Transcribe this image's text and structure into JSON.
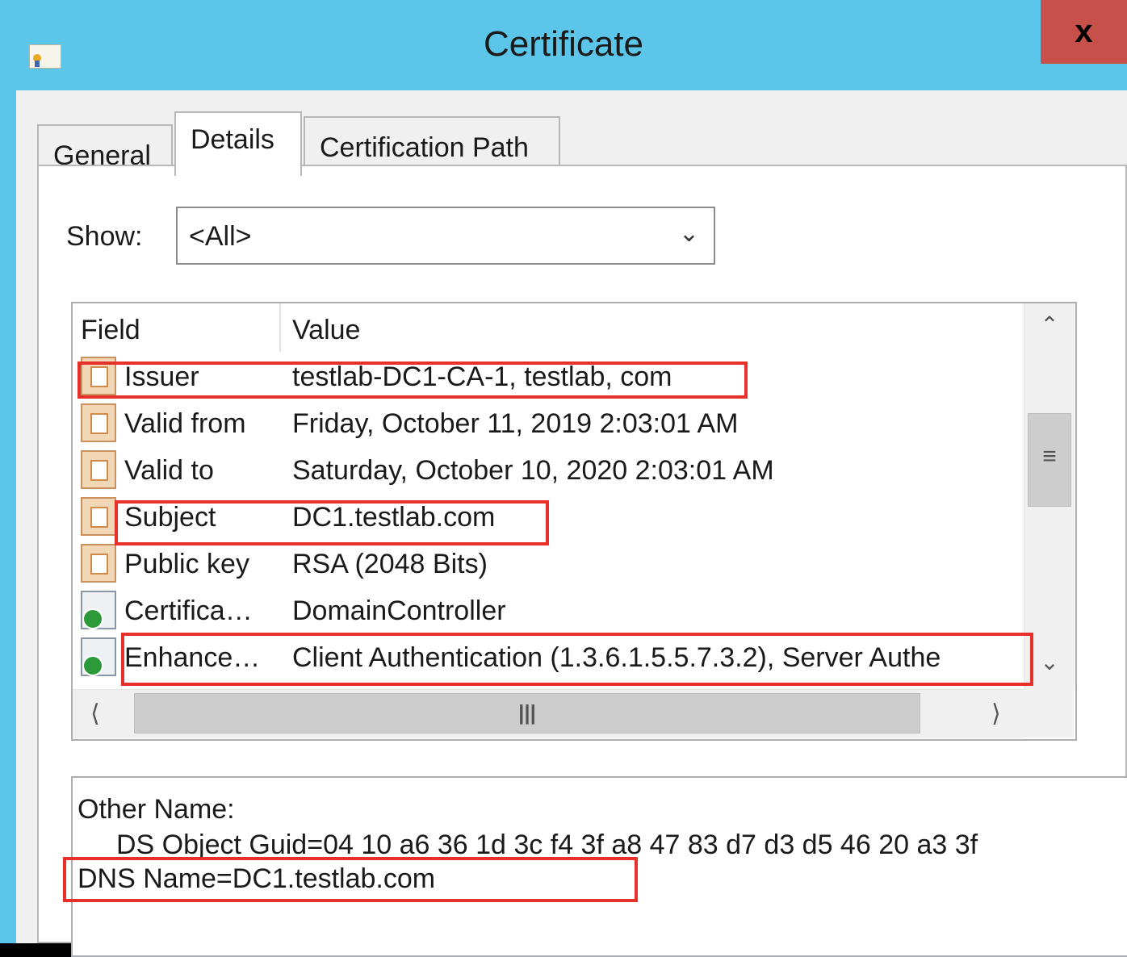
{
  "window": {
    "title": "Certificate",
    "close_label": "x"
  },
  "tabs": [
    {
      "label": "General",
      "active": false
    },
    {
      "label": "Details",
      "active": true
    },
    {
      "label": "Certification Path",
      "active": false
    }
  ],
  "show": {
    "label": "Show:",
    "value": "<All>"
  },
  "list": {
    "columns": [
      "Field",
      "Value"
    ],
    "rows": [
      {
        "field": "Issuer",
        "value": "testlab-DC1-CA-1, testlab, com",
        "icon": "certificate-field-icon"
      },
      {
        "field": "Valid from",
        "value": "Friday, October 11, 2019 2:03:01 AM",
        "icon": "certificate-field-icon"
      },
      {
        "field": "Valid to",
        "value": "Saturday, October 10, 2020 2:03:01 AM",
        "icon": "certificate-field-icon"
      },
      {
        "field": "Subject",
        "value": "DC1.testlab.com",
        "icon": "certificate-field-icon"
      },
      {
        "field": "Public key",
        "value": "RSA (2048 Bits)",
        "icon": "certificate-field-icon"
      },
      {
        "field": "Certifica…",
        "value": "DomainController",
        "icon": "certificate-extension-icon"
      },
      {
        "field": "Enhance…",
        "value": "Client Authentication (1.3.6.1.5.5.7.3.2), Server Authe",
        "icon": "certificate-extension-icon"
      }
    ]
  },
  "detail": {
    "lines": [
      "Other Name:",
      "DS Object Guid=04 10 a6 36 1d 3c f4 3f a8 47 83 d7 d3 d5 46 20 a3 3f",
      "DNS Name=DC1.testlab.com"
    ]
  },
  "colors": {
    "titlebar": "#5bc6ea",
    "close": "#c7504b",
    "highlight": "#e8302a"
  }
}
